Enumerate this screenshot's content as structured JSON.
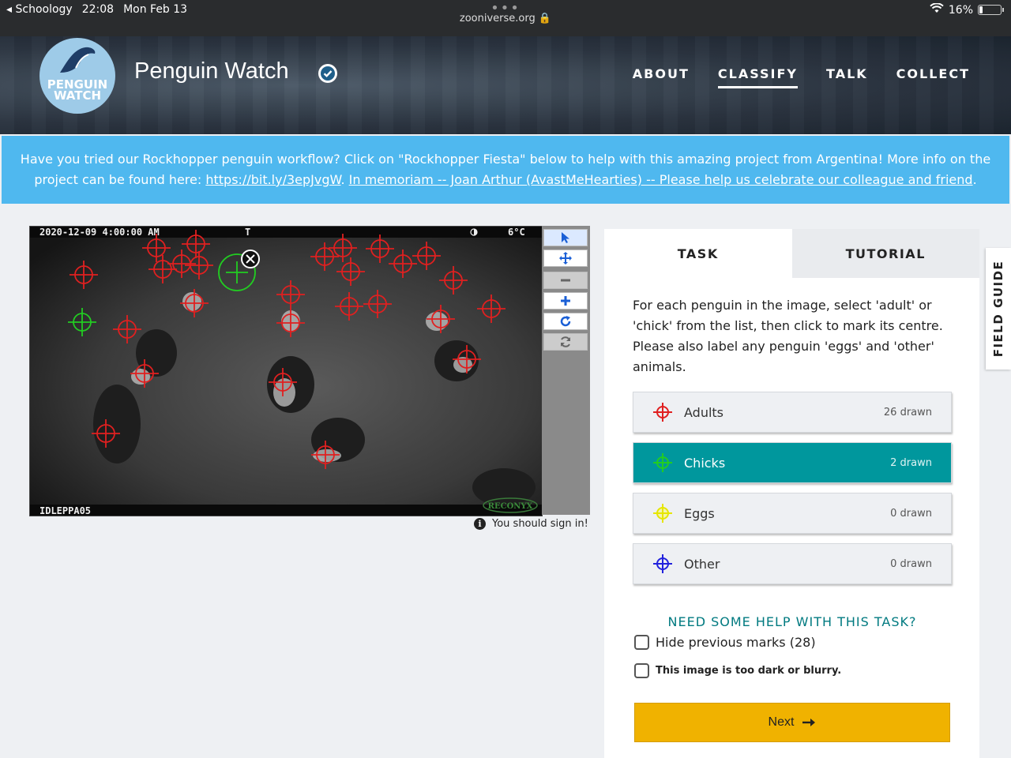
{
  "status_bar": {
    "app": "Schoology",
    "time": "22:08",
    "date": "Mon Feb 13",
    "url": "zooniverse.org",
    "battery": "16%"
  },
  "header": {
    "logo_text_1": "PENGUIN",
    "logo_text_2": "WATCH",
    "title": "Penguin Watch",
    "nav": [
      "ABOUT",
      "CLASSIFY",
      "TALK",
      "COLLECT"
    ]
  },
  "banner": {
    "text_1": "Have you tried our Rockhopper penguin workflow? Click on \"Rockhopper Fiesta\" below to help with this amazing project from Argentina! More info on the project can be found here: ",
    "link_1": "https://bit.ly/3epJvgW",
    "sep": ". ",
    "link_2": "In memoriam -- Joan Arthur (AvastMeHearties) -- Please help us celebrate our colleague and friend",
    "end": "."
  },
  "subject": {
    "timestamp": "2020-12-09  4:00:00 AM",
    "marker_t": "T",
    "temperature": "6°C",
    "camera_id": "IDLEPPA05",
    "brand": "RECONYX"
  },
  "signin_text": "You should sign in!",
  "task": {
    "tabs": [
      "TASK",
      "TUTORIAL"
    ],
    "instructions": "For each penguin in the image, select 'adult' or 'chick' from the list, then click to mark its centre. Please also label any penguin 'eggs' and 'other' animals.",
    "answers": [
      {
        "label": "Adults",
        "count": "26 drawn",
        "color": "#e02020"
      },
      {
        "label": "Chicks",
        "count": "2 drawn",
        "color": "#22cc22"
      },
      {
        "label": "Eggs",
        "count": "0 drawn",
        "color": "#e6e600"
      },
      {
        "label": "Other",
        "count": "0 drawn",
        "color": "#2222dd"
      }
    ],
    "help": "NEED SOME HELP WITH THIS TASK?",
    "hide_marks": "Hide previous marks (28)",
    "too_dark": "This image is too dark or blurry.",
    "next": "Next"
  },
  "field_guide": "FIELD GUIDE"
}
